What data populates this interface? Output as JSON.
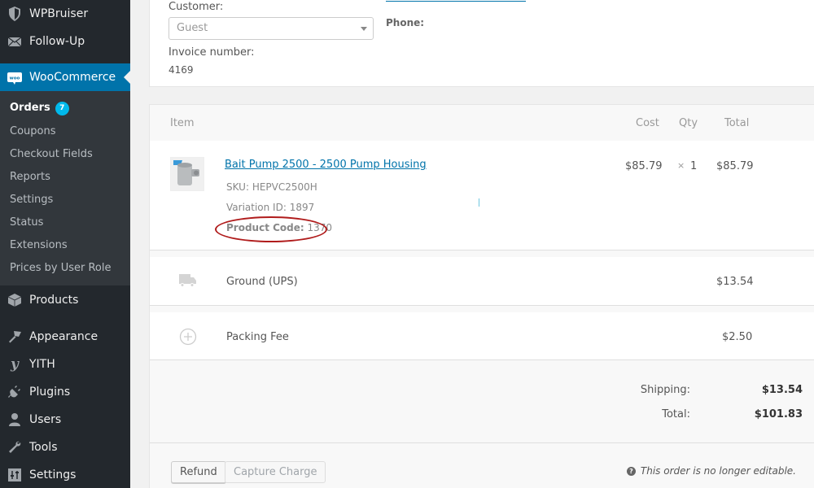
{
  "sidebar": {
    "top_items": [
      {
        "label": "WPBruiser",
        "icon": "shield-icon"
      },
      {
        "label": "Follow-Up",
        "icon": "envelope-icon"
      },
      {
        "label": "WooCommerce",
        "icon": "woocommerce-icon",
        "active": true
      }
    ],
    "submenu": [
      {
        "label": "Orders",
        "badge": "7",
        "current": true
      },
      {
        "label": "Coupons"
      },
      {
        "label": "Checkout Fields"
      },
      {
        "label": "Reports"
      },
      {
        "label": "Settings"
      },
      {
        "label": "Status"
      },
      {
        "label": "Extensions"
      },
      {
        "label": "Prices by User Role"
      }
    ],
    "bottom_items": [
      {
        "label": "Products",
        "icon": "box-icon"
      },
      {
        "label": "Appearance",
        "icon": "paintbrush-icon"
      },
      {
        "label": "YITH",
        "icon": "yith-icon"
      },
      {
        "label": "Plugins",
        "icon": "plug-icon"
      },
      {
        "label": "Users",
        "icon": "user-icon"
      },
      {
        "label": "Tools",
        "icon": "wrench-icon"
      },
      {
        "label": "Settings",
        "icon": "sliders-icon"
      }
    ],
    "colors": {
      "bg": "#23282d",
      "submenu_bg": "#32373c",
      "active": "#0073aa",
      "badge": "#00b9eb"
    }
  },
  "order": {
    "customer_label": "Customer:",
    "customer_value": "Guest",
    "phone_label": "Phone:",
    "invoice_label": "Invoice number:",
    "invoice_value": "4169"
  },
  "items_table": {
    "headers": {
      "item": "Item",
      "cost": "Cost",
      "qty": "Qty",
      "total": "Total"
    },
    "line_item": {
      "name": "Bait Pump 2500 - 2500 Pump Housing",
      "sku_label": "SKU:",
      "sku": "HEPVC2500H",
      "variation_label": "Variation ID:",
      "variation_id": "1897",
      "product_code_label": "Product Code:",
      "product_code": "1370",
      "cost": "$85.79",
      "qty_prefix": "×",
      "qty": "1",
      "total": "$85.79"
    },
    "shipping_line": {
      "name": "Ground (UPS)",
      "total": "$13.54",
      "icon": "truck-icon"
    },
    "fee_line": {
      "name": "Packing Fee",
      "total": "$2.50",
      "icon": "plus-circle-icon"
    },
    "totals": {
      "shipping_label": "Shipping:",
      "shipping_value": "$13.54",
      "total_label": "Total:",
      "total_value": "$101.83"
    }
  },
  "actions": {
    "refund_label": "Refund",
    "capture_label": "Capture Charge",
    "notice": "This order is no longer editable."
  },
  "annotation": {
    "color": "#b01c1c",
    "target": "product-code"
  }
}
